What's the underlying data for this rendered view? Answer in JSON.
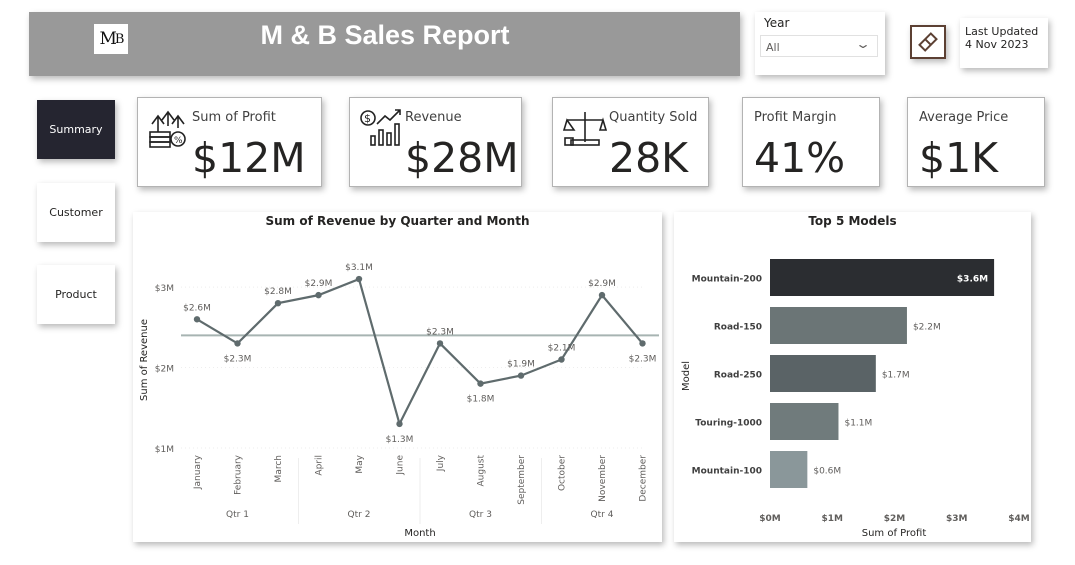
{
  "header": {
    "title": "M & B Sales Report",
    "logo_text": "MB",
    "brand_color": "#999999"
  },
  "filter": {
    "label": "Year",
    "value": "All"
  },
  "last_updated": "Last Updated 4 Nov 2023",
  "nav": [
    {
      "label": "Summary",
      "active": true
    },
    {
      "label": "Customer",
      "active": false
    },
    {
      "label": "Product",
      "active": false
    }
  ],
  "kpis": [
    {
      "title": "Sum of Profit",
      "value": "$12M",
      "icon": "profit-icon"
    },
    {
      "title": "Revenue",
      "value": "$28M",
      "icon": "revenue-chart-icon"
    },
    {
      "title": "Quantity Sold",
      "value": "28K",
      "icon": "scale-icon"
    },
    {
      "title": "Profit Margin",
      "value": "41%"
    },
    {
      "title": "Average Price",
      "value": "$1K"
    }
  ],
  "chart_data": [
    {
      "type": "line",
      "title": "Sum of Revenue by Quarter and Month",
      "xlabel": "Month",
      "ylabel": "Sum of Revenue",
      "categories": [
        "January",
        "February",
        "March",
        "April",
        "May",
        "June",
        "July",
        "August",
        "September",
        "October",
        "November",
        "December"
      ],
      "groups": [
        "Qtr 1",
        "Qtr 2",
        "Qtr 3",
        "Qtr 4"
      ],
      "values": [
        2.6,
        2.3,
        2.8,
        2.9,
        3.1,
        1.3,
        2.3,
        1.8,
        1.9,
        2.1,
        2.9,
        2.3
      ],
      "data_labels": [
        "$2.6M",
        "$2.3M",
        "$2.8M",
        "$2.9M",
        "$3.1M",
        "$1.3M",
        "$2.3M",
        "$1.8M",
        "$1.9M",
        "$2.1M",
        "$2.9M",
        "$2.3M"
      ],
      "average_line": 2.4,
      "yticks": [
        "$1M",
        "$2M",
        "$3M"
      ],
      "ylim": [
        1,
        3.2
      ],
      "color": "#5f6b6d"
    },
    {
      "type": "bar",
      "orientation": "horizontal",
      "title": "Top 5 Models",
      "xlabel": "Sum of Profit",
      "ylabel": "Model",
      "categories": [
        "Mountain-200",
        "Road-150",
        "Road-250",
        "Touring-1000",
        "Mountain-100"
      ],
      "values": [
        3.6,
        2.2,
        1.7,
        1.1,
        0.6
      ],
      "data_labels": [
        "$3.6M",
        "$2.2M",
        "$1.7M",
        "$1.1M",
        "$0.6M"
      ],
      "xticks": [
        "$0M",
        "$1M",
        "$2M",
        "$3M",
        "$4M"
      ],
      "xlim": [
        0,
        4
      ],
      "colors": [
        "#2b2d31",
        "#6b7576",
        "#5a6366",
        "#707b7c",
        "#8a979a"
      ]
    }
  ]
}
